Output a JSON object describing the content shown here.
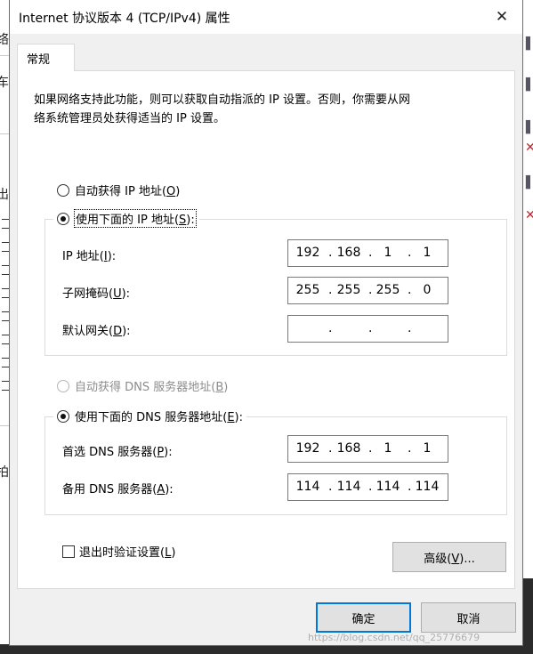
{
  "background": {
    "left_chars": [
      "络",
      "车",
      "出",
      "拍"
    ]
  },
  "dialog": {
    "title": "Internet 协议版本 4 (TCP/IPv4) 属性",
    "close_glyph": "✕"
  },
  "tab": {
    "label": "常规"
  },
  "description": {
    "line1": "如果网络支持此功能，则可以获取自动指派的 IP 设置。否则，你需要从网",
    "line2": "络系统管理员处获得适当的 IP 设置。"
  },
  "ip_section": {
    "auto_label": "自动获得 IP 地址(",
    "auto_key": "O",
    "manual_label": "使用下面的 IP 地址(",
    "manual_key": "S",
    "selected": "manual",
    "fields": [
      {
        "label": "IP 地址(",
        "key": "I",
        "octets": [
          "192",
          "168",
          "1",
          "1"
        ]
      },
      {
        "label": "子网掩码(",
        "key": "U",
        "octets": [
          "255",
          "255",
          "255",
          "0"
        ]
      },
      {
        "label": "默认网关(",
        "key": "D",
        "octets": [
          "",
          "",
          "",
          ""
        ]
      }
    ]
  },
  "dns_section": {
    "auto_label": "自动获得 DNS 服务器地址(",
    "auto_key": "B",
    "manual_label": "使用下面的 DNS 服务器地址(",
    "manual_key": "E",
    "selected": "manual",
    "fields": [
      {
        "label": "首选 DNS 服务器(",
        "key": "P",
        "octets": [
          "192",
          "168",
          "1",
          "1"
        ]
      },
      {
        "label": "备用 DNS 服务器(",
        "key": "A",
        "octets": [
          "114",
          "114",
          "114",
          "114"
        ]
      }
    ]
  },
  "validate": {
    "label": "退出时验证设置(",
    "key": "L",
    "checked": false
  },
  "buttons": {
    "advanced": "高级(",
    "advanced_key": "V",
    "advanced_suffix": ")...",
    "ok": "确定",
    "cancel": "取消"
  },
  "watermark": "https://blog.csdn.net/qq_25776679"
}
